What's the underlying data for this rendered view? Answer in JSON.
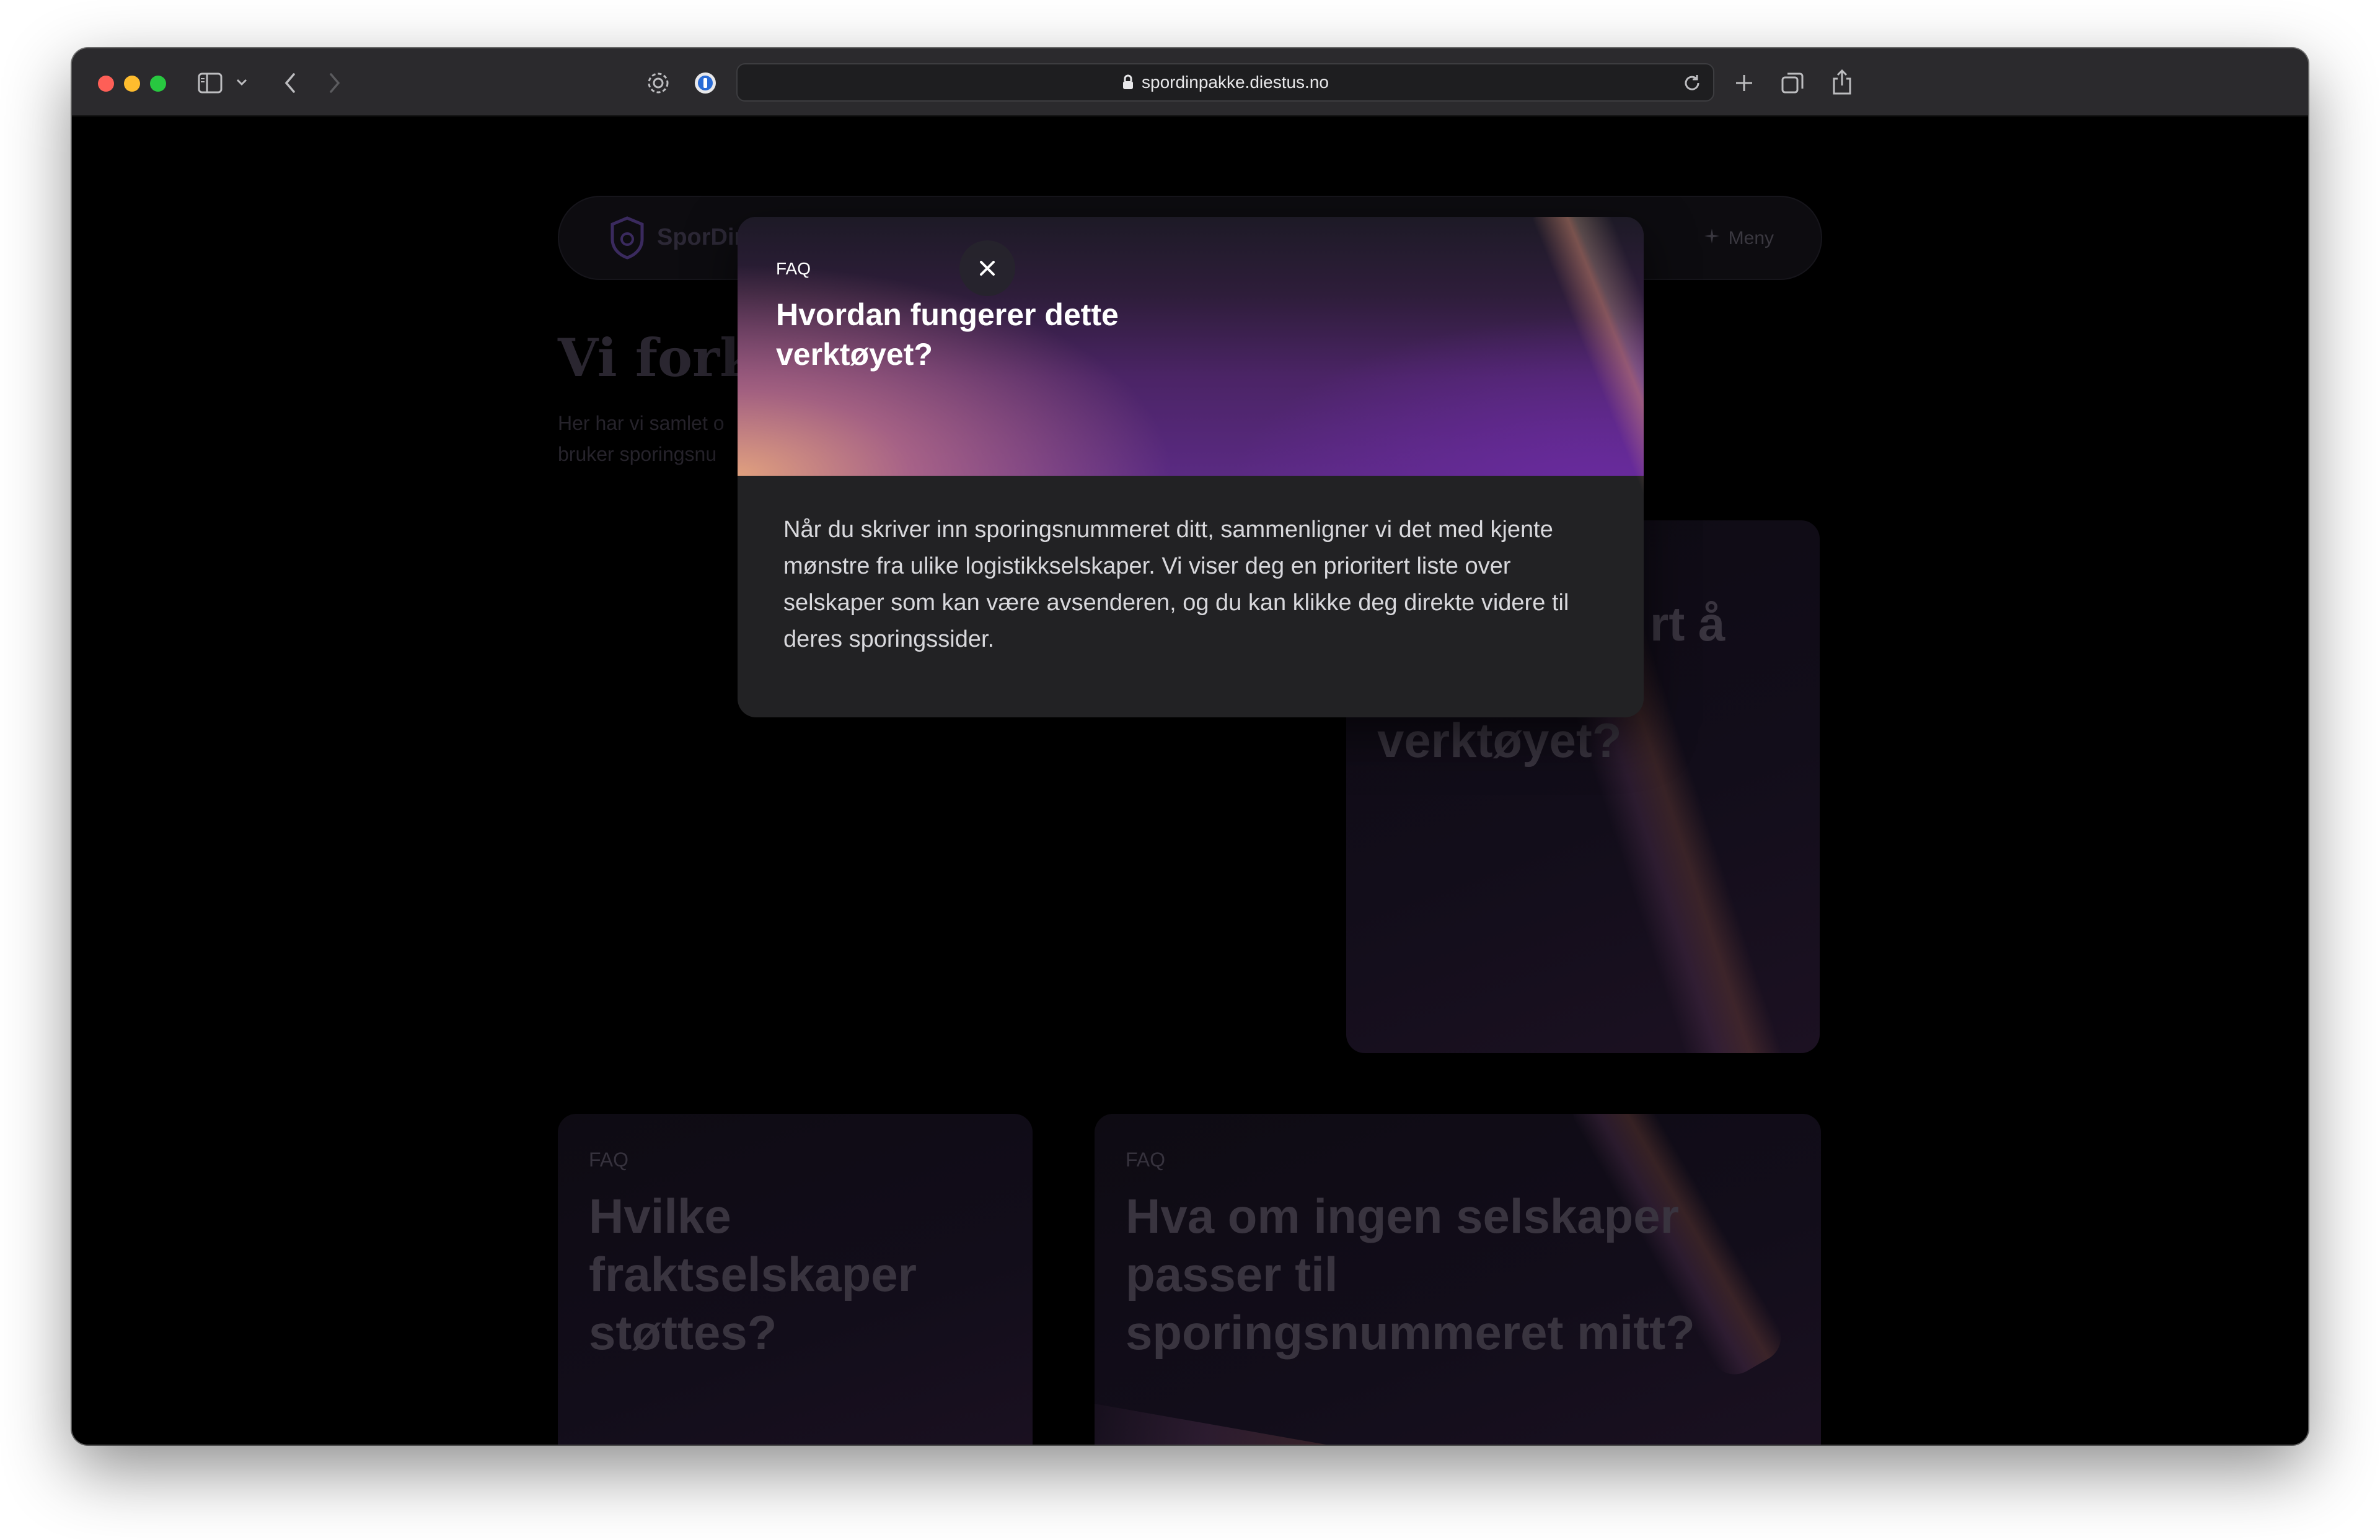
{
  "browser": {
    "url": "spordinpakke.diestus.no",
    "icons": [
      "sidebar-icon",
      "chevron-down-icon",
      "back-icon",
      "forward-icon",
      "settings-icon",
      "password-icon",
      "lock-icon",
      "reload-icon",
      "plus-icon",
      "tabs-icon",
      "share-icon"
    ]
  },
  "nav": {
    "brand": "SporDin",
    "menu_label": "Meny"
  },
  "hero": {
    "title": "Vi forkla",
    "subtitle_line1": "Her har vi samlet o",
    "subtitle_line2": "bruker sporingsnu"
  },
  "cards": [
    {
      "tag": "",
      "title_line1": "rt å",
      "title_line2": "verktøyet?"
    },
    {
      "tag": "FAQ",
      "title": [
        "Hvilke",
        "fraktselskaper",
        "støttes?"
      ]
    },
    {
      "tag": "FAQ",
      "title": [
        "Hva om ingen selskaper",
        "passer til",
        "sporingsnummeret mitt?"
      ]
    }
  ],
  "modal": {
    "tag": "FAQ",
    "title_line1": "Hvordan fungerer dette",
    "title_line2": "verktøyet?",
    "body": "Når du skriver inn sporingsnummeret ditt, sammenligner vi det med kjente mønstre fra ulike logistikkselskaper. Vi viser deg en prioritert liste over selskaper som kan være avsenderen, og du kan klikke deg direkte videre til deres sporingssider.",
    "close_icon": "close-icon"
  },
  "colors": {
    "traffic_red": "#fe5f57",
    "traffic_yellow": "#febc2e",
    "traffic_green": "#28c840",
    "modal_bg": "#222224",
    "page_bg": "#000000"
  }
}
